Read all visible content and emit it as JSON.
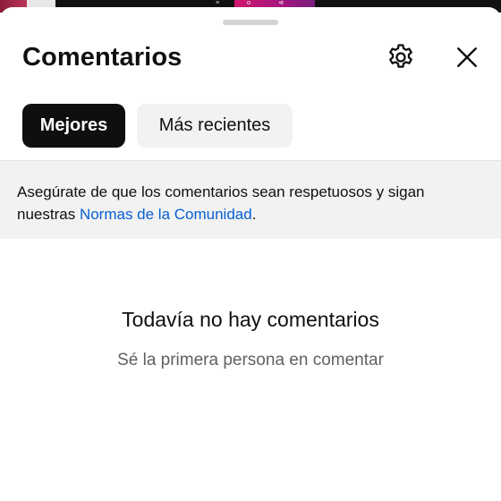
{
  "status_strip": {
    "glyph_left": "≡",
    "glyph_mid_1": "o",
    "glyph_mid_2": "⊲"
  },
  "header": {
    "title": "Comentarios",
    "settings_icon": "gear-icon",
    "close_icon": "close-icon"
  },
  "tabs": [
    {
      "label": "Mejores",
      "selected": true
    },
    {
      "label": "Más recientes",
      "selected": false
    }
  ],
  "notice": {
    "text_before": "Asegúrate de que los comentarios sean respetuosos y sigan nuestras ",
    "link_text": "Normas de la Comunidad",
    "text_after": "."
  },
  "empty_state": {
    "title": "Todavía no hay comentarios",
    "subtitle": "Sé la primera persona en comentar"
  },
  "colors": {
    "link": "#065fd4",
    "chip_active_bg": "#0f0f0f",
    "chip_inactive_bg": "#f2f2f2",
    "notice_bg": "#f2f2f2"
  }
}
